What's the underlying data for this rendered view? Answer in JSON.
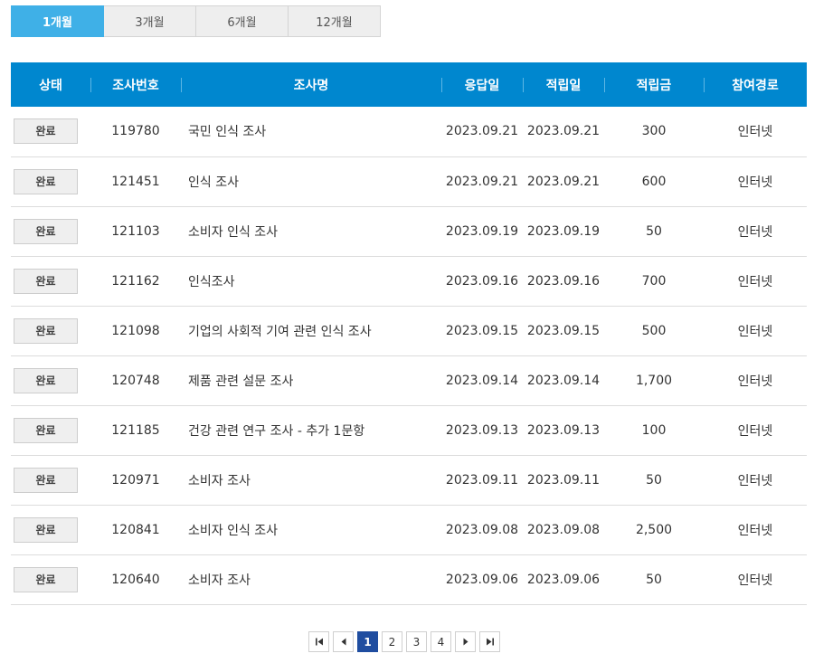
{
  "tabs": [
    {
      "label": "1개월",
      "active": true
    },
    {
      "label": "3개월",
      "active": false
    },
    {
      "label": "6개월",
      "active": false
    },
    {
      "label": "12개월",
      "active": false
    }
  ],
  "table": {
    "headers": [
      "상태",
      "조사번호",
      "조사명",
      "응답일",
      "적립일",
      "적립금",
      "참여경로"
    ],
    "rows": [
      {
        "status": "완료",
        "id": "119780",
        "name": "국민 인식 조사",
        "answered": "2023.09.21",
        "credited": "2023.09.21",
        "points": "300",
        "route": "인터넷"
      },
      {
        "status": "완료",
        "id": "121451",
        "name": "인식 조사",
        "answered": "2023.09.21",
        "credited": "2023.09.21",
        "points": "600",
        "route": "인터넷"
      },
      {
        "status": "완료",
        "id": "121103",
        "name": "소비자 인식 조사",
        "answered": "2023.09.19",
        "credited": "2023.09.19",
        "points": "50",
        "route": "인터넷"
      },
      {
        "status": "완료",
        "id": "121162",
        "name": "인식조사",
        "answered": "2023.09.16",
        "credited": "2023.09.16",
        "points": "700",
        "route": "인터넷"
      },
      {
        "status": "완료",
        "id": "121098",
        "name": "기업의 사회적 기여 관련 인식 조사",
        "answered": "2023.09.15",
        "credited": "2023.09.15",
        "points": "500",
        "route": "인터넷"
      },
      {
        "status": "완료",
        "id": "120748",
        "name": "제품 관련 설문 조사",
        "answered": "2023.09.14",
        "credited": "2023.09.14",
        "points": "1,700",
        "route": "인터넷"
      },
      {
        "status": "완료",
        "id": "121185",
        "name": "건강 관련 연구 조사 - 추가 1문항",
        "answered": "2023.09.13",
        "credited": "2023.09.13",
        "points": "100",
        "route": "인터넷"
      },
      {
        "status": "완료",
        "id": "120971",
        "name": "소비자 조사",
        "answered": "2023.09.11",
        "credited": "2023.09.11",
        "points": "50",
        "route": "인터넷"
      },
      {
        "status": "완료",
        "id": "120841",
        "name": "소비자 인식 조사",
        "answered": "2023.09.08",
        "credited": "2023.09.08",
        "points": "2,500",
        "route": "인터넷"
      },
      {
        "status": "완료",
        "id": "120640",
        "name": "소비자 조사",
        "answered": "2023.09.06",
        "credited": "2023.09.06",
        "points": "50",
        "route": "인터넷"
      }
    ]
  },
  "pagination": {
    "pages": [
      "1",
      "2",
      "3",
      "4"
    ],
    "current": "1",
    "icons": [
      "first-page-icon",
      "prev-page-icon",
      "next-page-icon",
      "last-page-icon"
    ]
  },
  "colors": {
    "header_bg": "#0087cf",
    "active_tab": "#3fb0e7",
    "current_page": "#1f4da0"
  }
}
